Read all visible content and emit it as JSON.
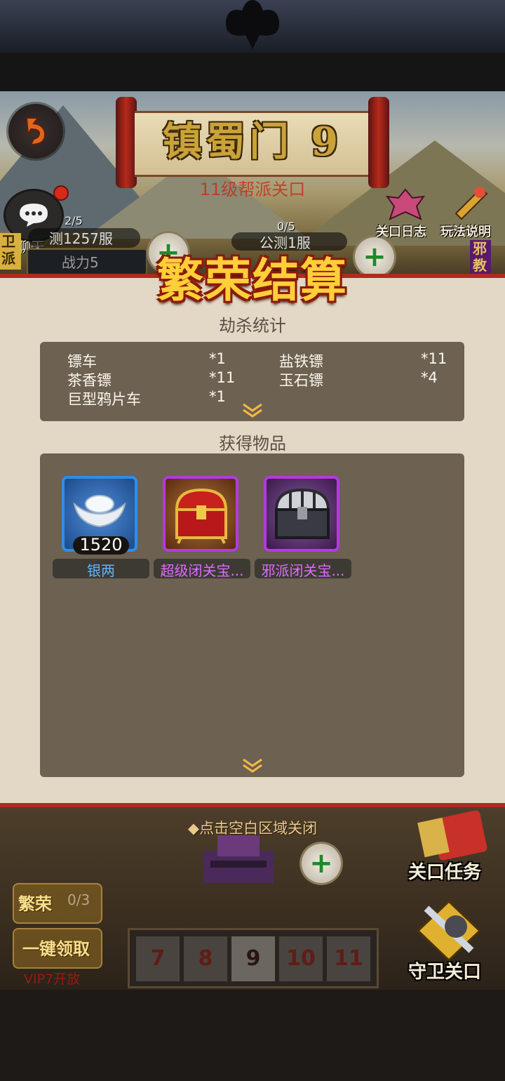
{
  "scene": {
    "stage_title": "镇蜀门 9",
    "stage_subtitle": "11级帮派关口",
    "chat_label": "聊天",
    "left_side_tag": "卫派",
    "left_count": "2/5",
    "left_server": "测1257服",
    "left_power": "战力5",
    "mid_count": "0/5",
    "mid_server": "公测1服",
    "log_label": "关口日志",
    "help_label": "玩法说明",
    "right_side_tag": "邪教"
  },
  "panel": {
    "title": "繁荣结算",
    "kill_heading": "劫杀统计",
    "kills": [
      {
        "name": "镖车",
        "count": "*1"
      },
      {
        "name": "盐铁镖",
        "count": "*11"
      },
      {
        "name": "茶香镖",
        "count": "*11"
      },
      {
        "name": "玉石镖",
        "count": "*4"
      },
      {
        "name": "巨型鸦片车",
        "count": "*1"
      }
    ],
    "items_heading": "获得物品",
    "items": [
      {
        "name": "银两",
        "quantity": "1520",
        "frame_color": "#2e8ee6",
        "name_color": "#5fb3ff"
      },
      {
        "name": "超级闭关宝...",
        "frame_color": "#b23adf",
        "name_color": "#de6cff"
      },
      {
        "name": "邪派闭关宝...",
        "frame_color": "#b23adf",
        "name_color": "#de6cff"
      }
    ]
  },
  "bottom": {
    "close_hint": "◆点击空白区域关闭",
    "prosperity_label": "繁荣",
    "prosperity_count": "0/3",
    "claim_label": "一键领取",
    "vip_note": "VIP7开放",
    "stages": [
      "7",
      "8",
      "9",
      "10",
      "11"
    ],
    "current_stage": "9",
    "task_label": "关口任务",
    "guard_label": "守卫关口"
  },
  "colors": {
    "accent_red": "#b02a20",
    "panel_bg": "#e3d8c6",
    "box_bg": "#6d6151",
    "title_gold": "#ffcf3a"
  }
}
